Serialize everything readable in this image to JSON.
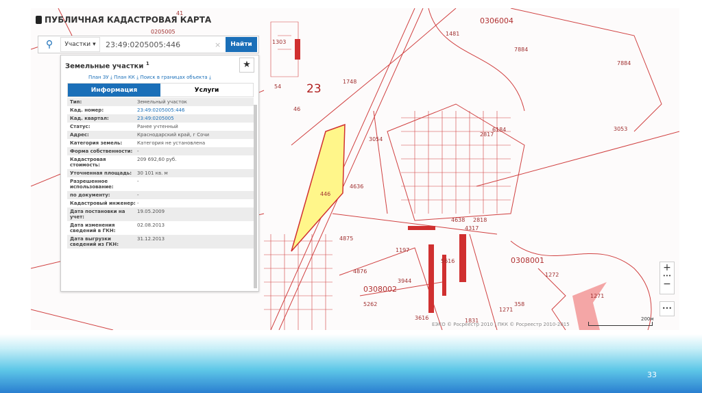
{
  "app": {
    "title": "ПУБЛИЧНАЯ КАДАСТРОВАЯ КАРТА"
  },
  "search": {
    "type": "Участки",
    "value": "23:49:0205005:446",
    "button": "Найти"
  },
  "panel": {
    "title": "Земельные участки",
    "count": "1",
    "links": "План ЗУ ⤓   План КК ⤓   Поиск в границах объекта ⤓",
    "tabs": [
      "Информация",
      "Услуги"
    ],
    "rows": [
      {
        "k": "Тип:",
        "v": "Земельный участок"
      },
      {
        "k": "Кад. номер:",
        "v": "23:49:0205005:446"
      },
      {
        "k": "Кад. квартал:",
        "v": "23:49:0205005"
      },
      {
        "k": "Статус:",
        "v": "Ранее учтенный"
      },
      {
        "k": "Адрес:",
        "v": "Краснодарский край, г Сочи"
      },
      {
        "k": "Категория земель:",
        "v": "Категория не установлена"
      },
      {
        "k": "Форма собственности:",
        "v": "-"
      },
      {
        "k": "Кадастровая стоимость:",
        "v": "209 692,60 руб."
      },
      {
        "k": "Уточненная площадь:",
        "v": "30 101 кв. м"
      },
      {
        "k": "Разрешенное использование:",
        "v": "-"
      },
      {
        "k": "по документу:",
        "v": "-"
      },
      {
        "k": "Кадастровый инженер:",
        "v": "-"
      },
      {
        "k": "Дата постановки на учет:",
        "v": "19.05.2009"
      },
      {
        "k": "Дата изменения сведений в ГКН:",
        "v": "02.08.2013"
      },
      {
        "k": "Дата выгрузки сведений из ГКН:",
        "v": "31.12.2013"
      }
    ]
  },
  "map": {
    "labels": [
      "0306004",
      "1481",
      "7884",
      "7884",
      "23",
      "1748",
      "54",
      "46",
      "3054",
      "3053",
      "4636",
      "446",
      "4875",
      "4876",
      "0308002",
      "3944",
      "5262",
      "1197",
      "5616",
      "4638",
      "2818",
      "4317",
      "2817",
      "6184",
      "0308001",
      "1272",
      "1271",
      "1271",
      "358",
      "1831",
      "3616",
      "1303",
      "0205005",
      "41"
    ],
    "attribution": "ЕЭКО © Росреестр 2010 | ПКК © Росреестр 2010-2015",
    "scale": "200м",
    "controls": {
      "zoom_in": "+",
      "more": "•••",
      "zoom_out": "−",
      "menu": "•••"
    }
  },
  "slide": {
    "page": "33"
  },
  "colors": {
    "accent": "#1a6fb8",
    "parcel": "#d03030",
    "selected": "#fff68a"
  }
}
